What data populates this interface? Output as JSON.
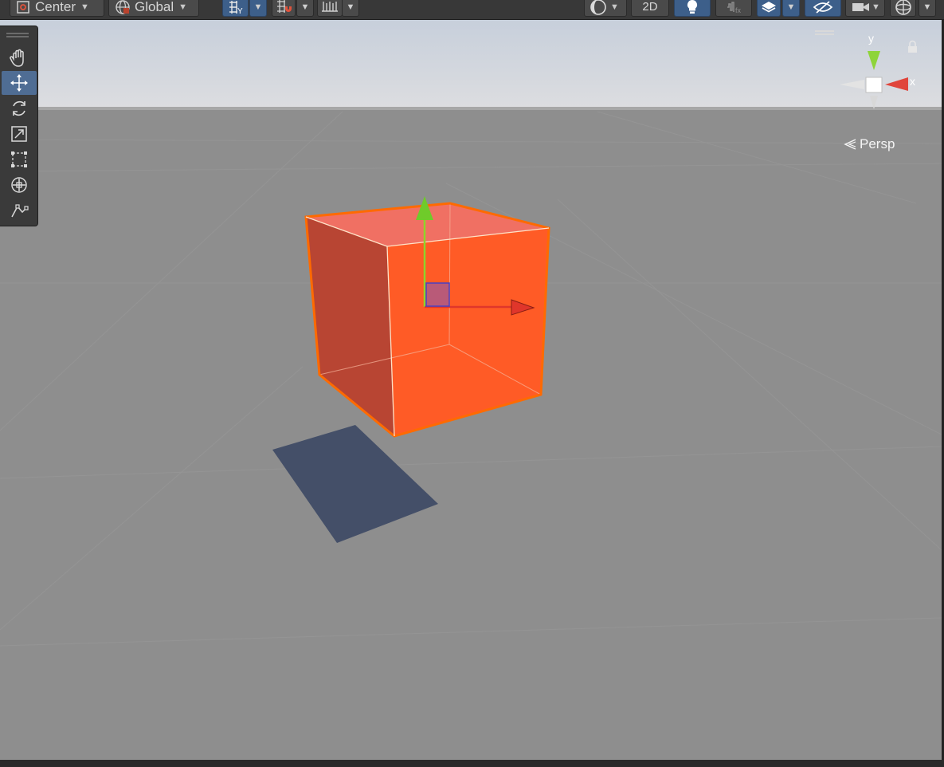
{
  "toolbar": {
    "pivot_mode": {
      "label": "Center",
      "icon": "pivot-center-icon"
    },
    "pivot_rotation": {
      "label": "Global",
      "icon": "globe-icon"
    },
    "draw_mode_label": "2D",
    "icons": [
      "grid-snap-icon",
      "increment-snap-icon",
      "ruler-icon",
      "shading-mode-icon",
      "lighting-icon",
      "audio-icon",
      "layers-icon",
      "visibility-icon",
      "camera-icon",
      "gizmos-icon"
    ]
  },
  "tools": [
    {
      "name": "hand-tool",
      "icon": "hand-icon",
      "active": false
    },
    {
      "name": "move-tool",
      "icon": "move-arrows-icon",
      "active": true
    },
    {
      "name": "rotate-tool",
      "icon": "rotate-icon",
      "active": false
    },
    {
      "name": "scale-tool",
      "icon": "scale-icon",
      "active": false
    },
    {
      "name": "rect-tool",
      "icon": "rect-transform-icon",
      "active": false
    },
    {
      "name": "transform-tool",
      "icon": "transform-icon",
      "active": false
    },
    {
      "name": "custom-tool",
      "icon": "custom-editor-tool-icon",
      "active": false
    }
  ],
  "view": {
    "projection_label": "Persp",
    "axis_y_label": "y",
    "axis_x_label": "x"
  },
  "colors": {
    "selection_outline": "#ff6a00",
    "cube_front": "#ff5a26",
    "cube_side": "#b94330",
    "cube_top": "#f07063",
    "axis_x": "#e0362b",
    "axis_y": "#8fd42a",
    "shadow": "#44506a",
    "ground": "#8d8d8d",
    "sky": "#d5dbe4",
    "active_tool": "#4f6d94",
    "toolbar_bg": "#383838"
  }
}
